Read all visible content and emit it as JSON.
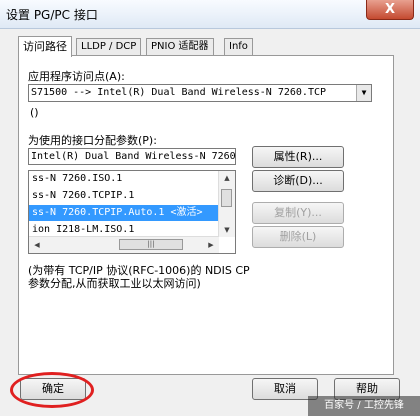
{
  "window": {
    "title": "设置 PG/PC 接口",
    "close_glyph": "X"
  },
  "tabs": [
    {
      "label": "访问路径",
      "active": true
    },
    {
      "label": "LLDP / DCP",
      "active": false
    },
    {
      "label": "PNIO 适配器",
      "active": false
    },
    {
      "label": "Info",
      "active": false
    }
  ],
  "access_point": {
    "label": "应用程序访问点(A):",
    "value": "S71500          --> Intel(R) Dual Band Wireless-N 7260.TCP",
    "sub_text": "()"
  },
  "interface_params": {
    "label": "为使用的接口分配参数(P):",
    "value": "Intel(R) Dual Band Wireless-N 7260",
    "items": [
      {
        "text": "ss-N 7260.ISO.1",
        "selected": false
      },
      {
        "text": "ss-N 7260.TCPIP.1",
        "selected": false
      },
      {
        "text": "ss-N 7260.TCPIP.Auto.1  <激活>",
        "selected": true
      },
      {
        "text": "ion I218-LM.ISO.1",
        "selected": false
      }
    ]
  },
  "side_buttons": {
    "properties": "属性(R)...",
    "diagnostics": "诊断(D)...",
    "copy": "复制(Y)...",
    "delete": "删除(L)"
  },
  "note": "(为带有 TCP/IP 协议(RFC-1006)的 NDIS CP 参数分配,从而获取工业以太网访问)",
  "footer": {
    "ok": "确定",
    "cancel": "取消",
    "help": "帮助"
  },
  "watermark": "百家号 / 工控先锋",
  "colors": {
    "selection": "#3399ff",
    "highlight_ring": "#e02020"
  }
}
